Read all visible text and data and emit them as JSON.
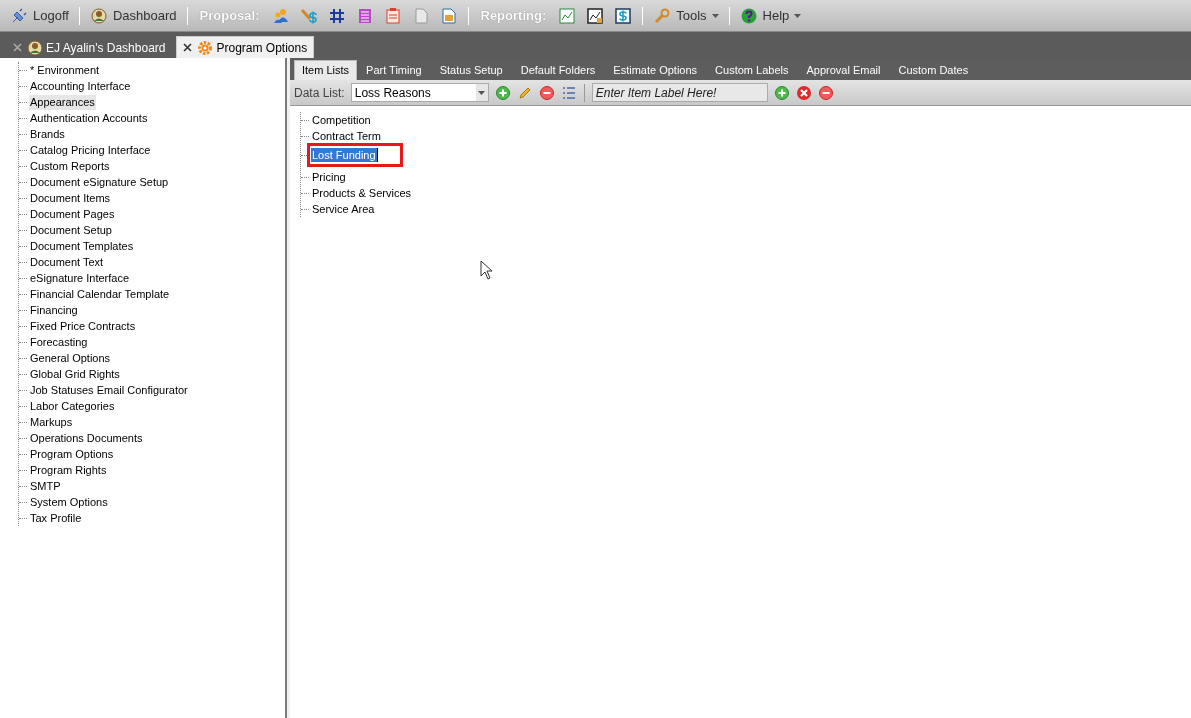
{
  "toolbar": {
    "items": [
      {
        "kind": "button",
        "label": "Logoff"
      },
      {
        "kind": "separator"
      },
      {
        "kind": "button",
        "label": "Dashboard"
      },
      {
        "kind": "separator"
      },
      {
        "kind": "heading",
        "label": "Proposal:"
      },
      {
        "kind": "icon"
      },
      {
        "kind": "icon"
      },
      {
        "kind": "icon"
      },
      {
        "kind": "icon"
      },
      {
        "kind": "icon"
      },
      {
        "kind": "icon"
      },
      {
        "kind": "icon"
      },
      {
        "kind": "separator"
      },
      {
        "kind": "heading",
        "label": "Reporting:"
      },
      {
        "kind": "icon"
      },
      {
        "kind": "icon"
      },
      {
        "kind": "icon"
      },
      {
        "kind": "separator"
      },
      {
        "kind": "menu",
        "label": "Tools"
      },
      {
        "kind": "separator"
      },
      {
        "kind": "menu",
        "label": "Help"
      }
    ]
  },
  "doc_tabs": [
    {
      "label": "EJ Ayalin's Dashboard",
      "selected": false
    },
    {
      "label": "Program Options",
      "selected": true
    }
  ],
  "sidebar": {
    "items": [
      {
        "label": "* Environment",
        "highlighted": false
      },
      {
        "label": "Accounting Interface",
        "highlighted": false
      },
      {
        "label": "Appearances",
        "highlighted": true
      },
      {
        "label": "Authentication Accounts",
        "highlighted": false
      },
      {
        "label": "Brands",
        "highlighted": false
      },
      {
        "label": "Catalog Pricing Interface",
        "highlighted": false
      },
      {
        "label": "Custom Reports",
        "highlighted": false
      },
      {
        "label": "Document eSignature Setup",
        "highlighted": false
      },
      {
        "label": "Document Items",
        "highlighted": false
      },
      {
        "label": "Document Pages",
        "highlighted": false
      },
      {
        "label": "Document Setup",
        "highlighted": false
      },
      {
        "label": "Document Templates",
        "highlighted": false
      },
      {
        "label": "Document Text",
        "highlighted": false
      },
      {
        "label": "eSignature Interface",
        "highlighted": false
      },
      {
        "label": "Financial Calendar Template",
        "highlighted": false
      },
      {
        "label": "Financing",
        "highlighted": false
      },
      {
        "label": "Fixed Price Contracts",
        "highlighted": false
      },
      {
        "label": "Forecasting",
        "highlighted": false
      },
      {
        "label": "General Options",
        "highlighted": false
      },
      {
        "label": "Global Grid Rights",
        "highlighted": false
      },
      {
        "label": "Job Statuses Email Configurator",
        "highlighted": false
      },
      {
        "label": "Labor Categories",
        "highlighted": false
      },
      {
        "label": "Markups",
        "highlighted": false
      },
      {
        "label": "Operations Documents",
        "highlighted": false
      },
      {
        "label": "Program Options",
        "highlighted": false
      },
      {
        "label": "Program Rights",
        "highlighted": false
      },
      {
        "label": "SMTP",
        "highlighted": false
      },
      {
        "label": "System Options",
        "highlighted": false
      },
      {
        "label": "Tax Profile",
        "highlighted": false
      }
    ]
  },
  "option_tabs": [
    {
      "label": "Item Lists",
      "selected": true
    },
    {
      "label": "Part Timing",
      "selected": false
    },
    {
      "label": "Status Setup",
      "selected": false
    },
    {
      "label": "Default Folders",
      "selected": false
    },
    {
      "label": "Estimate Options",
      "selected": false
    },
    {
      "label": "Custom Labels",
      "selected": false
    },
    {
      "label": "Approval Email",
      "selected": false
    },
    {
      "label": "Custom Dates",
      "selected": false
    }
  ],
  "data_list": {
    "label": "Data List:",
    "value": "Loss Reasons",
    "item_placeholder": "Enter Item Label Here!"
  },
  "items": [
    {
      "label": "Competition",
      "selected": false
    },
    {
      "label": "Contract Term",
      "selected": false
    },
    {
      "label": "Lost Funding",
      "selected": true
    },
    {
      "label": "Pricing",
      "selected": false
    },
    {
      "label": "Products & Services",
      "selected": false
    },
    {
      "label": "Service Area",
      "selected": false
    }
  ]
}
